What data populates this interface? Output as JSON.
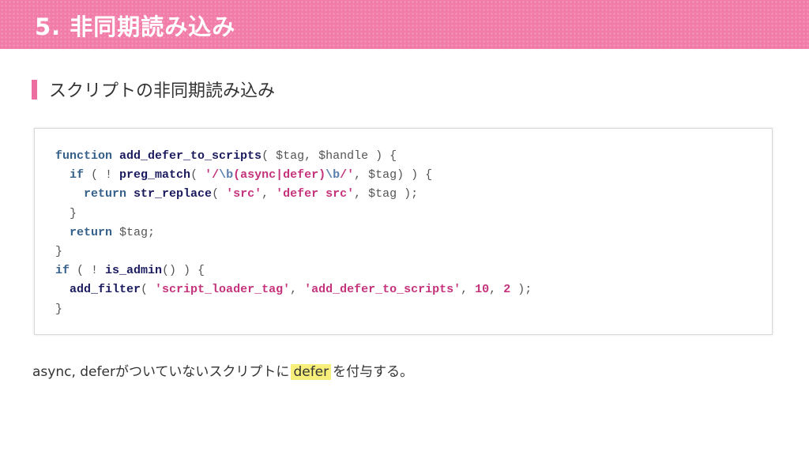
{
  "slide": {
    "title": "5. 非同期読み込み",
    "section_heading": "スクリプトの非同期読み込み",
    "caption_before": "async, deferがついていないスクリプトに",
    "caption_highlight": "defer",
    "caption_after": "を付与する。"
  },
  "code": {
    "line1": {
      "t1": "function",
      "t2": " ",
      "t3": "add_defer_to_scripts",
      "t4": "( $tag, $handle ) {"
    },
    "line2": {
      "indent": "  ",
      "t1": "if",
      "t2": " ( ! ",
      "t3": "preg_match",
      "t4": "( ",
      "s1": "'/",
      "s2": "\\b",
      "s3": "(async|defer)",
      "s4": "\\b",
      "s5": "/'",
      "t5": ", $tag) ) {"
    },
    "line3": {
      "indent": "    ",
      "t1": "return",
      "t2": " ",
      "t3": "str_replace",
      "t4": "( ",
      "s1": "'src'",
      "t5": ", ",
      "s2": "'defer src'",
      "t6": ", $tag );"
    },
    "line4": {
      "t1": "  }"
    },
    "line5": {
      "indent": "  ",
      "t1": "return",
      "t2": " $tag;"
    },
    "line6": {
      "t1": "}"
    },
    "line7": {
      "t1": "if",
      "t2": " ( ! ",
      "t3": "is_admin",
      "t4": "() ) {"
    },
    "line8": {
      "indent": "  ",
      "t1": "add_filter",
      "t2": "( ",
      "s1": "'script_loader_tag'",
      "t3": ", ",
      "s2": "'add_defer_to_scripts'",
      "t4": ", ",
      "n1": "10",
      "t5": ", ",
      "n2": "2",
      "t6": " );"
    },
    "line9": {
      "t1": "}"
    }
  },
  "colors": {
    "header_pink": "#f27ca8",
    "accent_bar": "#ec6d9f",
    "keyword": "#35608a",
    "function_name": "#1a1a5e",
    "string": "#c4337b",
    "regex_escape": "#5a7fae",
    "highlight": "#f8ef7a"
  }
}
